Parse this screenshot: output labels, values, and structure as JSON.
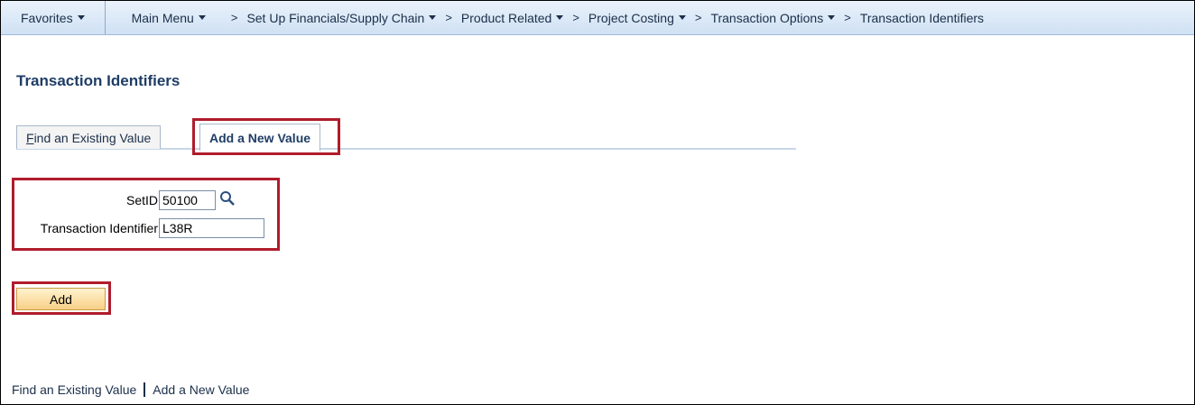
{
  "nav": {
    "favorites": "Favorites",
    "main_menu": "Main Menu",
    "crumbs": [
      "Set Up Financials/Supply Chain",
      "Product Related",
      "Project Costing",
      "Transaction Options",
      "Transaction Identifiers"
    ],
    "crumb_separator": ">"
  },
  "page": {
    "title": "Transaction Identifiers"
  },
  "tabs": {
    "find_first_letter": "F",
    "find_rest": "ind an Existing Value",
    "add": "Add a New Value"
  },
  "form": {
    "setid_label": "SetID",
    "setid_value": "50100",
    "trans_label": "Transaction Identifier",
    "trans_value": "L38R"
  },
  "buttons": {
    "add": "Add"
  },
  "footer": {
    "find_link": "Find an Existing Value",
    "add_link": "Add a New Value"
  },
  "colors": {
    "highlight": "#b01c2c",
    "title": "#1f3d66"
  },
  "icons": {
    "lookup": "magnifier-icon",
    "dropdown": "caret-down-icon"
  }
}
